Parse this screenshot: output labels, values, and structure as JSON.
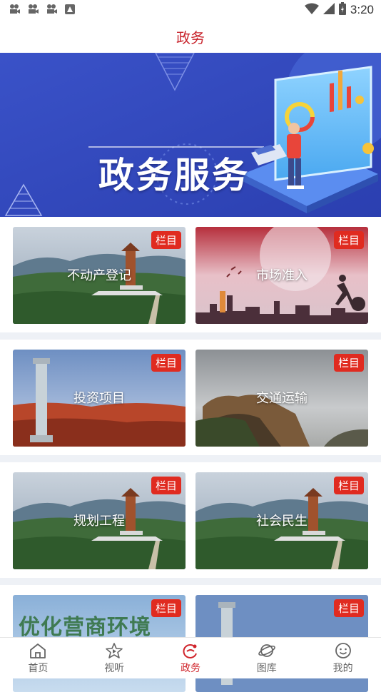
{
  "status": {
    "time": "3:20"
  },
  "header": {
    "title": "政务"
  },
  "banner": {
    "text": "政务服务"
  },
  "cards": [
    {
      "label": "不动产登记",
      "badge": "栏目"
    },
    {
      "label": "市场准入",
      "badge": "栏目"
    },
    {
      "label": "投资项目",
      "badge": "栏目"
    },
    {
      "label": "交通运输",
      "badge": "栏目"
    },
    {
      "label": "规划工程",
      "badge": "栏目"
    },
    {
      "label": "社会民生",
      "badge": "栏目"
    },
    {
      "label": "优化营商环境",
      "badge": "栏目"
    },
    {
      "label": "",
      "badge": "栏目"
    }
  ],
  "tabs": [
    {
      "label": "首页"
    },
    {
      "label": "视听"
    },
    {
      "label": "政务"
    },
    {
      "label": "图库"
    },
    {
      "label": "我的"
    }
  ],
  "colors": {
    "accent": "#d0242b",
    "badge": "#e02b20"
  }
}
